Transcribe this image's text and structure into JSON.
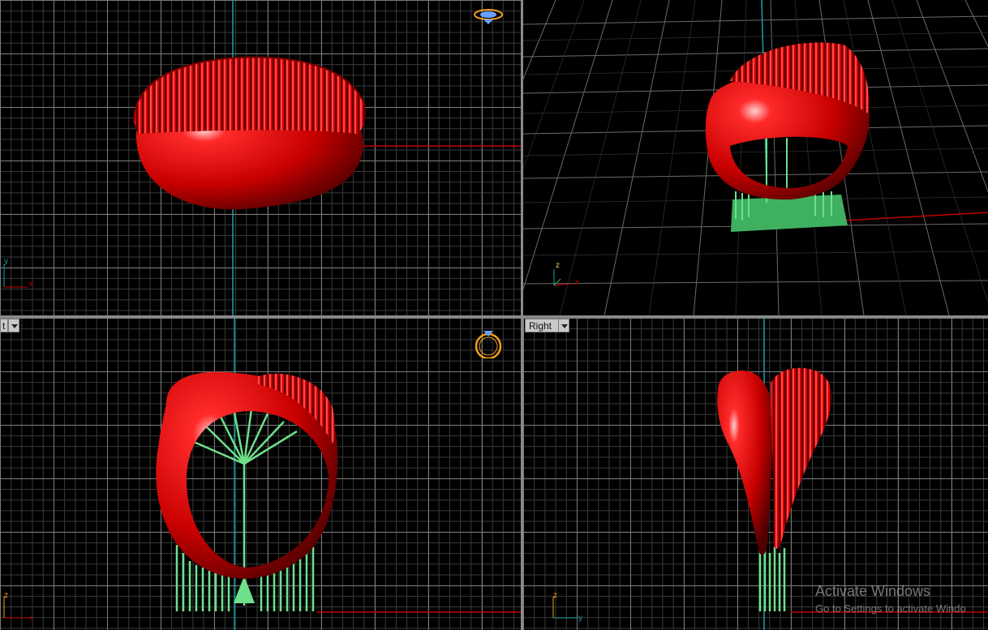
{
  "viewports": {
    "top": {
      "axis_x": "x",
      "axis_y": "y"
    },
    "perspective": {
      "axis_x": "x",
      "axis_y": "y",
      "axis_z": "z"
    },
    "front": {
      "label": "t",
      "axis_x": "x",
      "axis_z": "z"
    },
    "right": {
      "label": "Right",
      "axis_y": "y",
      "axis_z": "z"
    }
  },
  "watermark": {
    "title": "Activate Windows",
    "subtitle": "Go to Settings to activate Windo"
  },
  "colors": {
    "background": "#000000",
    "model": "#e00000",
    "supports": "#5fcf7a",
    "axis_x": "#c00000",
    "axis_y": "#1aa0a8",
    "widget": "#f0a020"
  }
}
